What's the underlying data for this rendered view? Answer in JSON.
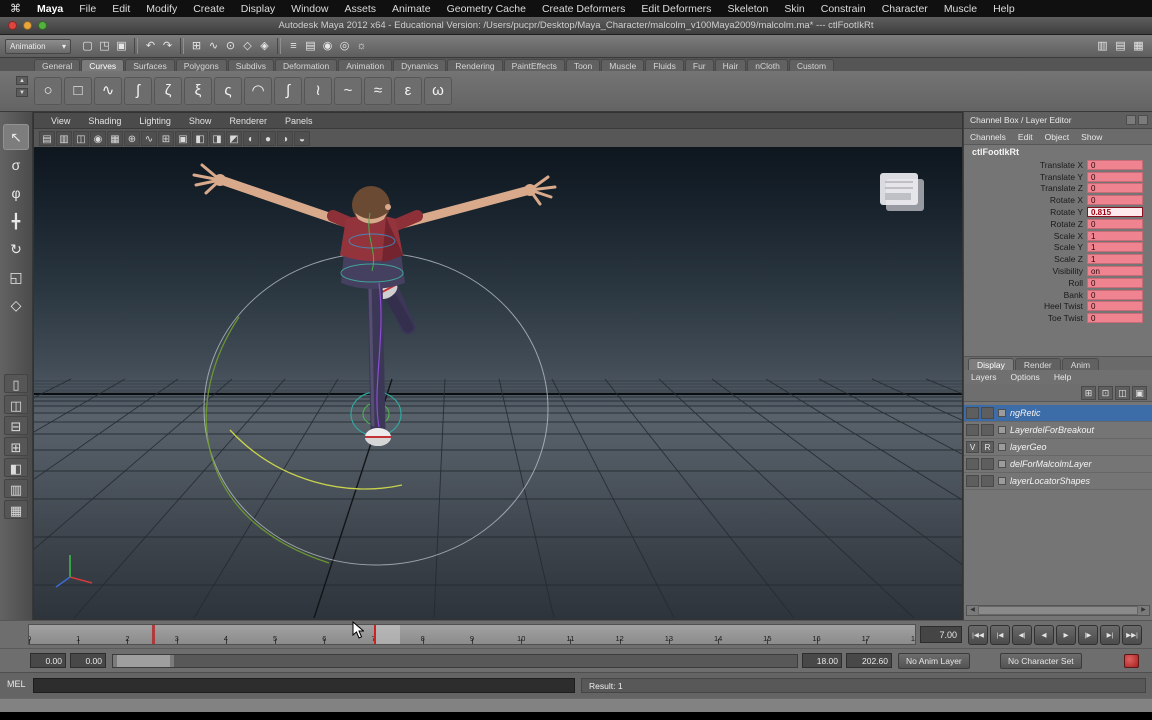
{
  "mac_menu": {
    "items": [
      "Maya",
      "File",
      "Edit",
      "Modify",
      "Create",
      "Display",
      "Window",
      "Assets",
      "Animate",
      "Geometry Cache",
      "Create Deformers",
      "Edit Deformers",
      "Skeleton",
      "Skin",
      "Constrain",
      "Character",
      "Muscle",
      "Help"
    ]
  },
  "title_bar": {
    "title": "Autodesk Maya 2012 x64 - Educational Version: /Users/pucpr/Desktop/Maya_Character/malcolm_v100Maya2009/malcolm.ma* --- ctlFootIkRt"
  },
  "status_line": {
    "menu_set": "Animation",
    "icons": [
      {
        "name": "new-scene-icon",
        "glyph": "▢"
      },
      {
        "name": "open-scene-icon",
        "glyph": "◳"
      },
      {
        "name": "save-scene-icon",
        "glyph": "▣"
      },
      {
        "name": "separator"
      },
      {
        "name": "undo-icon",
        "glyph": "↶"
      },
      {
        "name": "redo-icon",
        "glyph": "↷"
      },
      {
        "name": "separator"
      },
      {
        "name": "snap-to-grid-icon",
        "glyph": "⊞"
      },
      {
        "name": "snap-to-curve-icon",
        "glyph": "∿"
      },
      {
        "name": "snap-to-point-icon",
        "glyph": "⊙"
      },
      {
        "name": "snap-to-plane-icon",
        "glyph": "◇"
      },
      {
        "name": "make-live-icon",
        "glyph": "◈"
      },
      {
        "name": "separator"
      },
      {
        "name": "construction-history-icon",
        "glyph": "≡"
      },
      {
        "name": "render-view-icon",
        "glyph": "▤"
      },
      {
        "name": "render-current-frame-icon",
        "glyph": "◉"
      },
      {
        "name": "ipr-render-icon",
        "glyph": "◎"
      },
      {
        "name": "render-settings-icon",
        "glyph": "☼"
      }
    ],
    "right_icons": [
      {
        "name": "attribute-editor-toggle-icon",
        "glyph": "▥"
      },
      {
        "name": "tool-settings-toggle-icon",
        "glyph": "▤"
      },
      {
        "name": "channel-box-toggle-icon",
        "glyph": "▦"
      }
    ]
  },
  "shelf": {
    "active_tab": "Curves",
    "tabs": [
      "General",
      "Curves",
      "Surfaces",
      "Polygons",
      "Subdivs",
      "Deformation",
      "Animation",
      "Dynamics",
      "Rendering",
      "PaintEffects",
      "Toon",
      "Muscle",
      "Fluids",
      "Fur",
      "Hair",
      "nCloth",
      "Custom"
    ],
    "icons": [
      {
        "name": "nurbs-circle-icon",
        "glyph": "○"
      },
      {
        "name": "nurbs-square-icon",
        "glyph": "□"
      },
      {
        "name": "cv-curve-tool-icon",
        "glyph": "∿"
      },
      {
        "name": "ep-curve-tool-icon",
        "glyph": "ʃ"
      },
      {
        "name": "bezier-curve-tool-icon",
        "glyph": "ζ"
      },
      {
        "name": "pencil-curve-tool-icon",
        "glyph": "ξ"
      },
      {
        "name": "arc-three-point-icon",
        "glyph": "ς"
      },
      {
        "name": "arc-two-point-icon",
        "glyph": "◠"
      },
      {
        "name": "attach-curves-icon",
        "glyph": "∫"
      },
      {
        "name": "detach-curves-icon",
        "glyph": "≀"
      },
      {
        "name": "insert-knot-icon",
        "glyph": "~"
      },
      {
        "name": "extend-curve-icon",
        "glyph": "≈"
      },
      {
        "name": "offset-curve-icon",
        "glyph": "ε"
      },
      {
        "name": "rebuild-curve-icon",
        "glyph": "ω"
      }
    ]
  },
  "toolbox": {
    "tools": [
      {
        "name": "select-tool-icon",
        "glyph": "↖",
        "active": true
      },
      {
        "name": "lasso-select-tool-icon",
        "glyph": "σ"
      },
      {
        "name": "paint-select-tool-icon",
        "glyph": "φ"
      },
      {
        "name": "move-tool-icon",
        "glyph": "╋"
      },
      {
        "name": "rotate-tool-icon",
        "glyph": "↻"
      },
      {
        "name": "scale-tool-icon",
        "glyph": "◱"
      },
      {
        "name": "last-tool-icon",
        "glyph": "◇"
      }
    ],
    "layouts": [
      {
        "name": "layout-single-pane-icon",
        "glyph": "▯"
      },
      {
        "name": "layout-two-side-icon",
        "glyph": "◫"
      },
      {
        "name": "layout-two-stacked-icon",
        "glyph": "⊟"
      },
      {
        "name": "layout-four-pane-icon",
        "glyph": "⊞"
      },
      {
        "name": "layout-persp-outliner-icon",
        "glyph": "◧"
      },
      {
        "name": "layout-hypergraph-icon",
        "glyph": "▥"
      },
      {
        "name": "layout-persp-graph-icon",
        "glyph": "▦"
      }
    ]
  },
  "viewport": {
    "menus": [
      "View",
      "Shading",
      "Lighting",
      "Show",
      "Renderer",
      "Panels"
    ],
    "icons": [
      {
        "name": "select-camera-icon",
        "glyph": "▤"
      },
      {
        "name": "lock-camera-icon",
        "glyph": "▥"
      },
      {
        "name": "camera-attributes-icon",
        "glyph": "◫"
      },
      {
        "name": "bookmark-icon",
        "glyph": "◉"
      },
      {
        "name": "image-plane-toolbar-icon",
        "glyph": "▦"
      },
      {
        "name": "two-d-pan-zoom-icon",
        "glyph": "⊕"
      },
      {
        "name": "grease-pencil-icon",
        "glyph": "∿"
      },
      {
        "name": "grid-toggle-icon",
        "glyph": "⊞"
      },
      {
        "name": "film-gate-icon",
        "glyph": "▣"
      },
      {
        "name": "resolution-gate-icon",
        "glyph": "◧"
      },
      {
        "name": "gate-mask-icon",
        "glyph": "◨"
      },
      {
        "name": "field-chart-icon",
        "glyph": "◩"
      },
      {
        "name": "wireframe-icon",
        "glyph": "◐"
      },
      {
        "name": "smooth-shade-icon",
        "glyph": "●"
      },
      {
        "name": "textured-icon",
        "glyph": "◑"
      },
      {
        "name": "xray-icon",
        "glyph": "◒"
      }
    ]
  },
  "channel_box": {
    "header": "Channel Box / Layer Editor",
    "menus": [
      "Channels",
      "Edit",
      "Object",
      "Show"
    ],
    "object_name": "ctlFootIkRt",
    "channels": [
      {
        "label": "Translate X",
        "value": "0"
      },
      {
        "label": "Translate Y",
        "value": "0"
      },
      {
        "label": "Translate Z",
        "value": "0"
      },
      {
        "label": "Rotate X",
        "value": "0"
      },
      {
        "label": "Rotate Y",
        "value": "0.815",
        "editing": true
      },
      {
        "label": "Rotate Z",
        "value": "0"
      },
      {
        "label": "Scale X",
        "value": "1"
      },
      {
        "label": "Scale Y",
        "value": "1"
      },
      {
        "label": "Scale Z",
        "value": "1"
      },
      {
        "label": "Visibility",
        "value": "on"
      },
      {
        "label": "Roll",
        "value": "0"
      },
      {
        "label": "Bank",
        "value": "0"
      },
      {
        "label": "Heel Twist",
        "value": "0"
      },
      {
        "label": "Toe Twist",
        "value": "0"
      }
    ]
  },
  "layer_editor": {
    "tabs": [
      "Display",
      "Render",
      "Anim"
    ],
    "active_tab": "Display",
    "menus": [
      "Layers",
      "Options",
      "Help"
    ],
    "icons": [
      {
        "name": "new-empty-layer-icon",
        "glyph": "⊞"
      },
      {
        "name": "new-layer-from-selected-icon",
        "glyph": "⊡"
      },
      {
        "name": "new-anim-layer-icon",
        "glyph": "◫"
      },
      {
        "name": "new-anim-layer-from-selected-icon",
        "glyph": "▣"
      }
    ],
    "layers": [
      {
        "name": "ngRetic",
        "selected": true,
        "v": "",
        "t": ""
      },
      {
        "name": "LayerdelForBreakout",
        "v": "",
        "t": ""
      },
      {
        "name": "layerGeo",
        "v": "V",
        "t": "R"
      },
      {
        "name": "delForMalcolmLayer",
        "v": "",
        "t": ""
      },
      {
        "name": "layerLocatorShapes",
        "v": "",
        "t": ""
      }
    ]
  },
  "timeline": {
    "start": 0,
    "end": 18,
    "label_every": 1,
    "current": 7,
    "current_label": "7.00",
    "key_frames": [
      2.5
    ],
    "playback_buttons": [
      {
        "name": "go-to-start-button",
        "glyph": "|◀◀"
      },
      {
        "name": "step-back-frame-button",
        "glyph": "|◀"
      },
      {
        "name": "step-back-key-button",
        "glyph": "◀|"
      },
      {
        "name": "play-backwards-button",
        "glyph": "◀"
      },
      {
        "name": "play-forwards-button",
        "glyph": "▶"
      },
      {
        "name": "step-forward-key-button",
        "glyph": "|▶"
      },
      {
        "name": "step-forward-frame-button",
        "glyph": "▶|"
      },
      {
        "name": "go-to-end-button",
        "glyph": "▶▶|"
      }
    ]
  },
  "range_slider": {
    "anim_start": "0.00",
    "play_start": "0.00",
    "play_end": "18.00",
    "anim_end": "202.60",
    "anim_layer_label": "No Anim Layer",
    "character_set_label": "No Character Set"
  },
  "command_line": {
    "label": "MEL",
    "input": "",
    "result": "Result: 1"
  },
  "help_line": {
    "text": ""
  },
  "colors": {
    "keyed_channel": "#ef8390",
    "selection_blue": "#3d6da8",
    "playhead_red": "#cc2222"
  }
}
